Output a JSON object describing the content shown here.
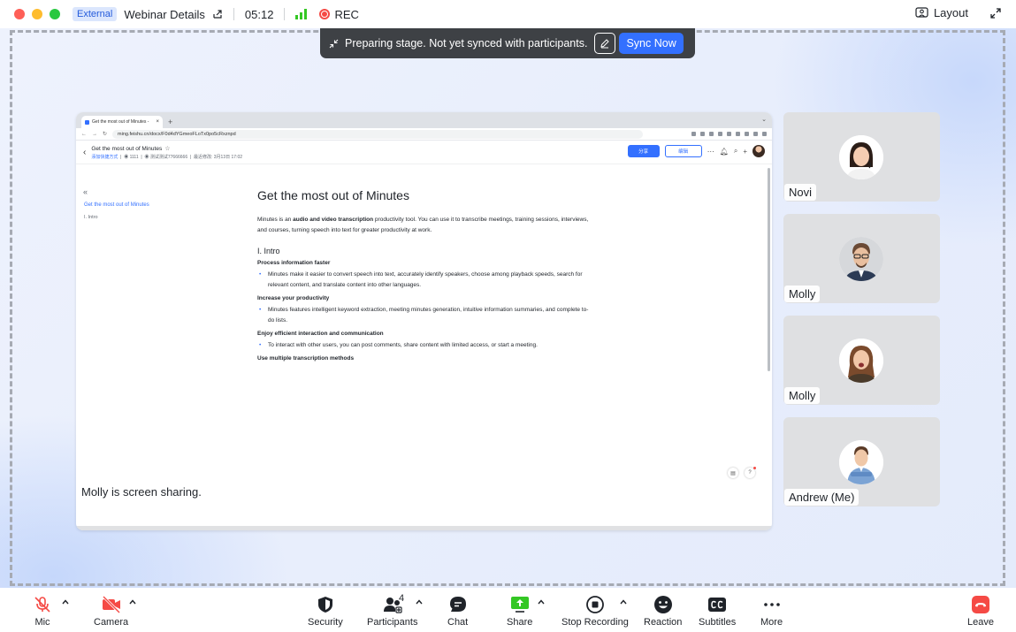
{
  "titlebar": {
    "external_badge": "External",
    "meeting_title": "Webinar Details",
    "timer": "05:12",
    "rec_label": "REC",
    "layout_label": "Layout"
  },
  "banner": {
    "message": "Preparing stage. Not yet synced with participants.",
    "sync_label": "Sync Now"
  },
  "shared_screen": {
    "browser_tab": "Get the most out of Minutes - ",
    "url": "ming.feishu.cn/docx/F0d4dYGmeoFLoTx0po5cRxznpd",
    "doc_title": "Get the most out of Minutes",
    "doc_meta_link": "添加快捷方式",
    "doc_meta_count": "1111",
    "doc_meta_owner": "测试测试77666666",
    "doc_meta_modified": "最近修改: 3月13日 17:02",
    "share_btn": "分享",
    "edit_btn": "编辑",
    "toc_items": [
      "Get the most out of Minutes",
      "I. Intro"
    ],
    "heading": "Get the most out of Minutes",
    "intro_before": "Minutes is an ",
    "intro_bold": "audio and video transcription",
    "intro_after": " productivity tool. You can use it to transcribe meetings, training sessions, interviews, and courses, turning speech into text for greater productivity at work.",
    "section": "I. Intro",
    "sub1": "Process information faster",
    "bullet1": "Minutes make it easier to convert speech into text, accurately identify speakers, choose among playback speeds, search for relevant content, and translate content into other languages.",
    "sub2": "Increase your productivity",
    "bullet2": "Minutes features intelligent keyword extraction, meeting minutes generation, intuitive information summaries, and complete to-do lists.",
    "sub3": "Enjoy efficient interaction and communication",
    "bullet3": "To interact with other users, you can post comments, share content with limited access, or start a meeting.",
    "sub4": "Use multiple transcription methods"
  },
  "sharing_label": "Molly is screen sharing.",
  "participants_tiles": [
    {
      "name": "Novi"
    },
    {
      "name": "Molly"
    },
    {
      "name": "Molly"
    },
    {
      "name": "Andrew (Me)"
    }
  ],
  "toolbar": {
    "mic": "Mic",
    "camera": "Camera",
    "security": "Security",
    "participants": "Participants",
    "participants_count": "4",
    "chat": "Chat",
    "share": "Share",
    "stop_recording": "Stop Recording",
    "reaction": "Reaction",
    "subtitles": "Subtitles",
    "more": "More",
    "leave": "Leave"
  },
  "colors": {
    "accent": "#3370ff",
    "record_red": "#f54a45",
    "signal_green": "#34c724",
    "share_green": "#34c724",
    "leave_red": "#f54a45"
  }
}
